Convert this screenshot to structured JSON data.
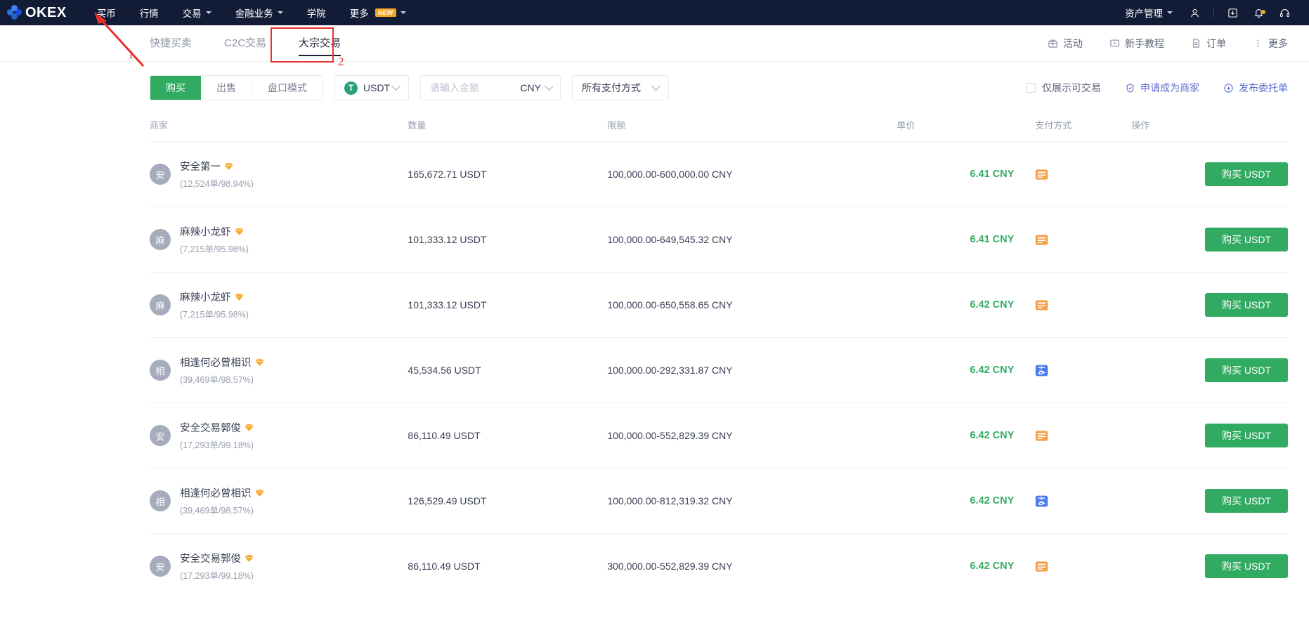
{
  "brand": {
    "name": "OKEX"
  },
  "topnav": {
    "items": [
      {
        "label": "买币",
        "has_caret": false,
        "badge": null
      },
      {
        "label": "行情",
        "has_caret": false,
        "badge": null
      },
      {
        "label": "交易",
        "has_caret": true,
        "badge": null
      },
      {
        "label": "金融业务",
        "has_caret": true,
        "badge": null
      },
      {
        "label": "学院",
        "has_caret": false,
        "badge": null
      },
      {
        "label": "更多",
        "has_caret": true,
        "badge": "NEW"
      }
    ],
    "right": {
      "assets_label": "资产管理",
      "icons": [
        "user-icon",
        "download-icon",
        "bell-icon",
        "headset-icon"
      ]
    }
  },
  "subnav": {
    "tabs": [
      {
        "label": "快捷买卖",
        "active": false
      },
      {
        "label": "C2C交易",
        "active": false
      },
      {
        "label": "大宗交易",
        "active": true
      }
    ],
    "links": [
      {
        "label": "活动",
        "icon": "gift-icon"
      },
      {
        "label": "新手教程",
        "icon": "video-icon"
      },
      {
        "label": "订单",
        "icon": "document-icon"
      },
      {
        "label": "更多",
        "icon": "more-vertical-icon"
      }
    ]
  },
  "filters": {
    "side_tabs": [
      {
        "label": "购买",
        "active": true
      },
      {
        "label": "出售",
        "active": false
      },
      {
        "label": "盘口模式",
        "active": false
      }
    ],
    "coin": {
      "symbol": "USDT",
      "badge_letter": "T"
    },
    "amount": {
      "value": "",
      "placeholder": "请输入金额",
      "currency": "CNY"
    },
    "payment": {
      "label": "所有支付方式"
    },
    "only_tradable": {
      "label": "仅展示可交易",
      "checked": false
    },
    "apply_merchant": {
      "label": "申请成为商家",
      "icon": "shield-check-icon"
    },
    "publish_order": {
      "label": "发布委托单",
      "icon": "plus-circle-icon"
    }
  },
  "table": {
    "headers": {
      "merchant": "商家",
      "amount": "数量",
      "limit": "限额",
      "price": "单价",
      "payment": "支付方式",
      "action": "操作"
    },
    "buy_button_label": "购买 USDT",
    "rows": [
      {
        "avatar": "安",
        "name": "安全第一",
        "stats": "(12,524单/98.94%)",
        "amount": "165,672.71 USDT",
        "limit": "100,000.00-600,000.00 CNY",
        "price": "6.41 CNY",
        "payment_icon": "bank-card-icon"
      },
      {
        "avatar": "麻",
        "name": "麻辣小龙虾",
        "stats": "(7,215单/95.98%)",
        "amount": "101,333.12 USDT",
        "limit": "100,000.00-649,545.32 CNY",
        "price": "6.41 CNY",
        "payment_icon": "bank-card-icon"
      },
      {
        "avatar": "麻",
        "name": "麻辣小龙虾",
        "stats": "(7,215单/95.98%)",
        "amount": "101,333.12 USDT",
        "limit": "100,000.00-650,558.65 CNY",
        "price": "6.42 CNY",
        "payment_icon": "bank-card-icon"
      },
      {
        "avatar": "相",
        "name": "相逢何必曾相识",
        "stats": "(39,469单/98.57%)",
        "amount": "45,534.56 USDT",
        "limit": "100,000.00-292,331.87 CNY",
        "price": "6.42 CNY",
        "payment_icon": "alipay-icon"
      },
      {
        "avatar": "安",
        "name": "安全交易郭俊",
        "stats": "(17,293单/99.18%)",
        "amount": "86,110.49 USDT",
        "limit": "100,000.00-552,829.39 CNY",
        "price": "6.42 CNY",
        "payment_icon": "bank-card-icon"
      },
      {
        "avatar": "相",
        "name": "相逢何必曾相识",
        "stats": "(39,469单/98.57%)",
        "amount": "126,529.49 USDT",
        "limit": "100,000.00-812,319.32 CNY",
        "price": "6.42 CNY",
        "payment_icon": "alipay-icon"
      },
      {
        "avatar": "安",
        "name": "安全交易郭俊",
        "stats": "(17,293单/99.18%)",
        "amount": "86,110.49 USDT",
        "limit": "300,000.00-552,829.39 CNY",
        "price": "6.42 CNY",
        "payment_icon": "bank-card-icon"
      }
    ]
  },
  "annotations": [
    {
      "label": "1",
      "target": "买币"
    },
    {
      "label": "2",
      "target": "大宗交易"
    }
  ],
  "colors": {
    "accent_green": "#32ab62",
    "nav_bg": "#131c36",
    "link_blue": "#5b6ad0",
    "annotation_red": "#e8302a",
    "alipay_blue": "#4b7bec",
    "bankcard_orange": "#f5a04a"
  }
}
